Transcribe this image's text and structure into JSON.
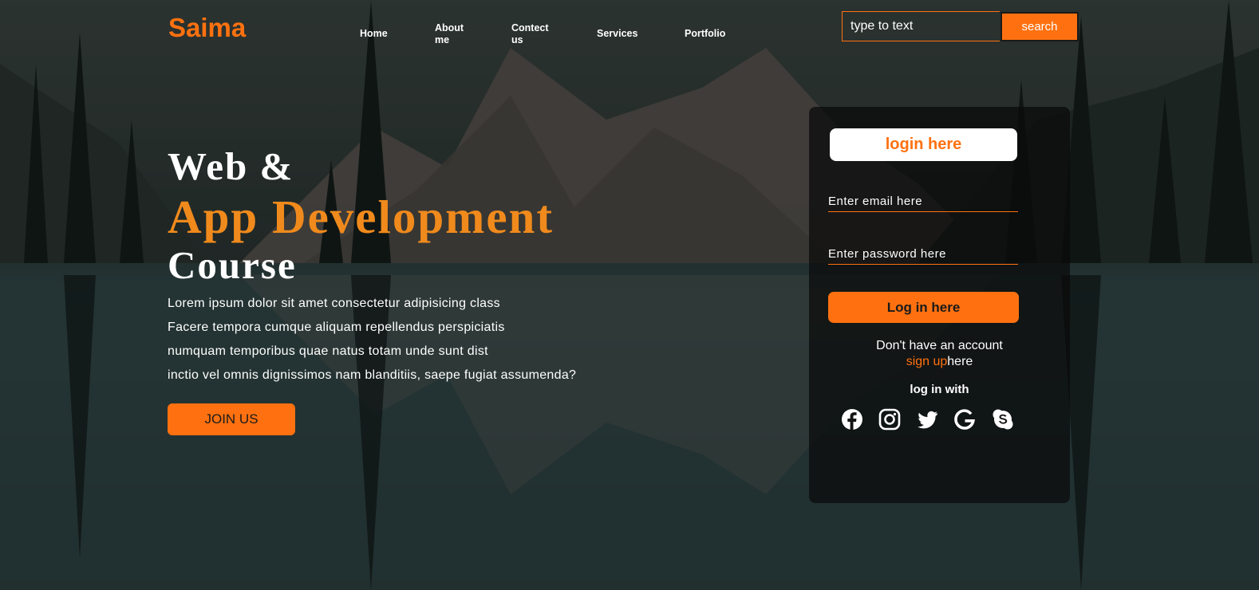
{
  "brand": {
    "name": "Saima",
    "accent": "#ff7110"
  },
  "nav": {
    "items": [
      {
        "label": "Home"
      },
      {
        "label": "About me"
      },
      {
        "label": "Contect us"
      },
      {
        "label": "Services"
      },
      {
        "label": "Portfolio"
      }
    ]
  },
  "search": {
    "placeholder": "type to text",
    "button_label": "search"
  },
  "hero": {
    "line1": "Web &",
    "line2": "App Development",
    "line3": "Course",
    "paragraph": [
      "Lorem ipsum dolor sit amet consectetur adipisicing class",
      "Facere tempora cumque aliquam repellendus perspiciatis",
      "numquam temporibus quae natus totam unde sunt dist",
      "inctio vel omnis dignissimos nam blanditiis, saepe fugiat assumenda?"
    ],
    "cta_label": "JOIN US"
  },
  "login": {
    "title": "login here",
    "email_placeholder": "Enter email here",
    "password_placeholder": "Enter password here",
    "button_label": "Log in here",
    "no_account": "Don't have an account",
    "signup_link": "sign up",
    "signup_suffix": "here",
    "login_with": "log in with",
    "socials": [
      "facebook-icon",
      "instagram-icon",
      "twitter-icon",
      "google-icon",
      "skype-icon"
    ]
  }
}
